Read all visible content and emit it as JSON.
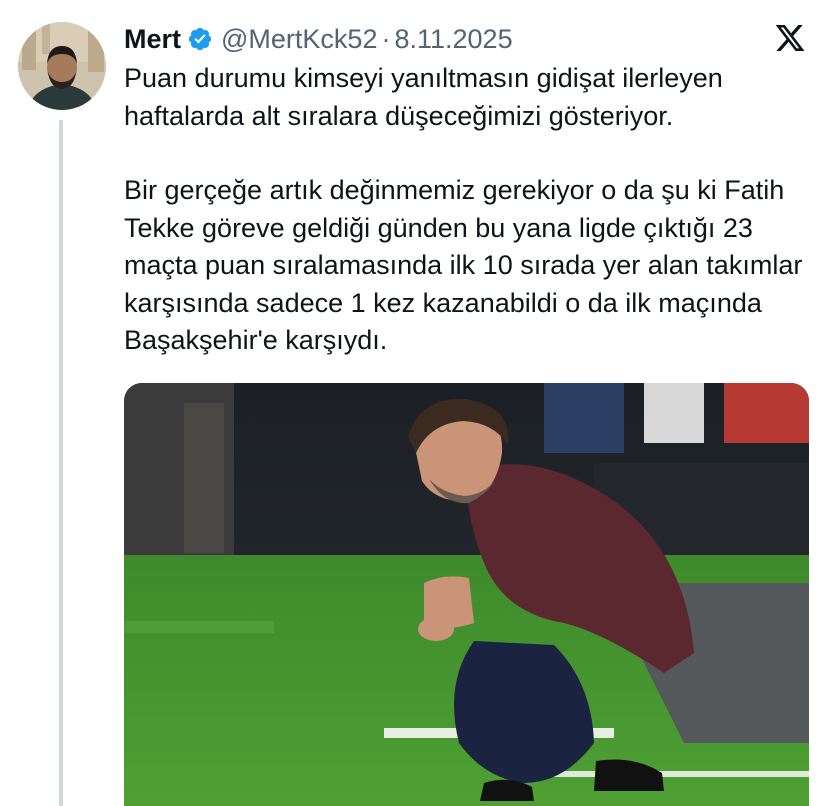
{
  "tweet": {
    "author_name": "Mert",
    "handle": "@MertKck52",
    "separator": "·",
    "date": "8.11.2025",
    "verified_color": "#1d9bf0",
    "paragraphs": [
      "Puan durumu kimseyi yanıltmasın gidişat ilerleyen haftalarda alt sıralara düşeceğimizi gösteriyor.",
      "Bir gerçeğe artık değinmemiz gerekiyor o da şu ki Fatih Tekke göreve geldiği günden bu yana ligde çıktığı 23 maçta puan sıralamasında ilk 10 sırada yer alan takımlar karşısında sadece 1 kez kazanabildi o da ilk maçında Başakşehir'e karşıydı."
    ]
  },
  "icons": {
    "verified": "verified-badge-icon",
    "platform": "x-logo-icon"
  }
}
